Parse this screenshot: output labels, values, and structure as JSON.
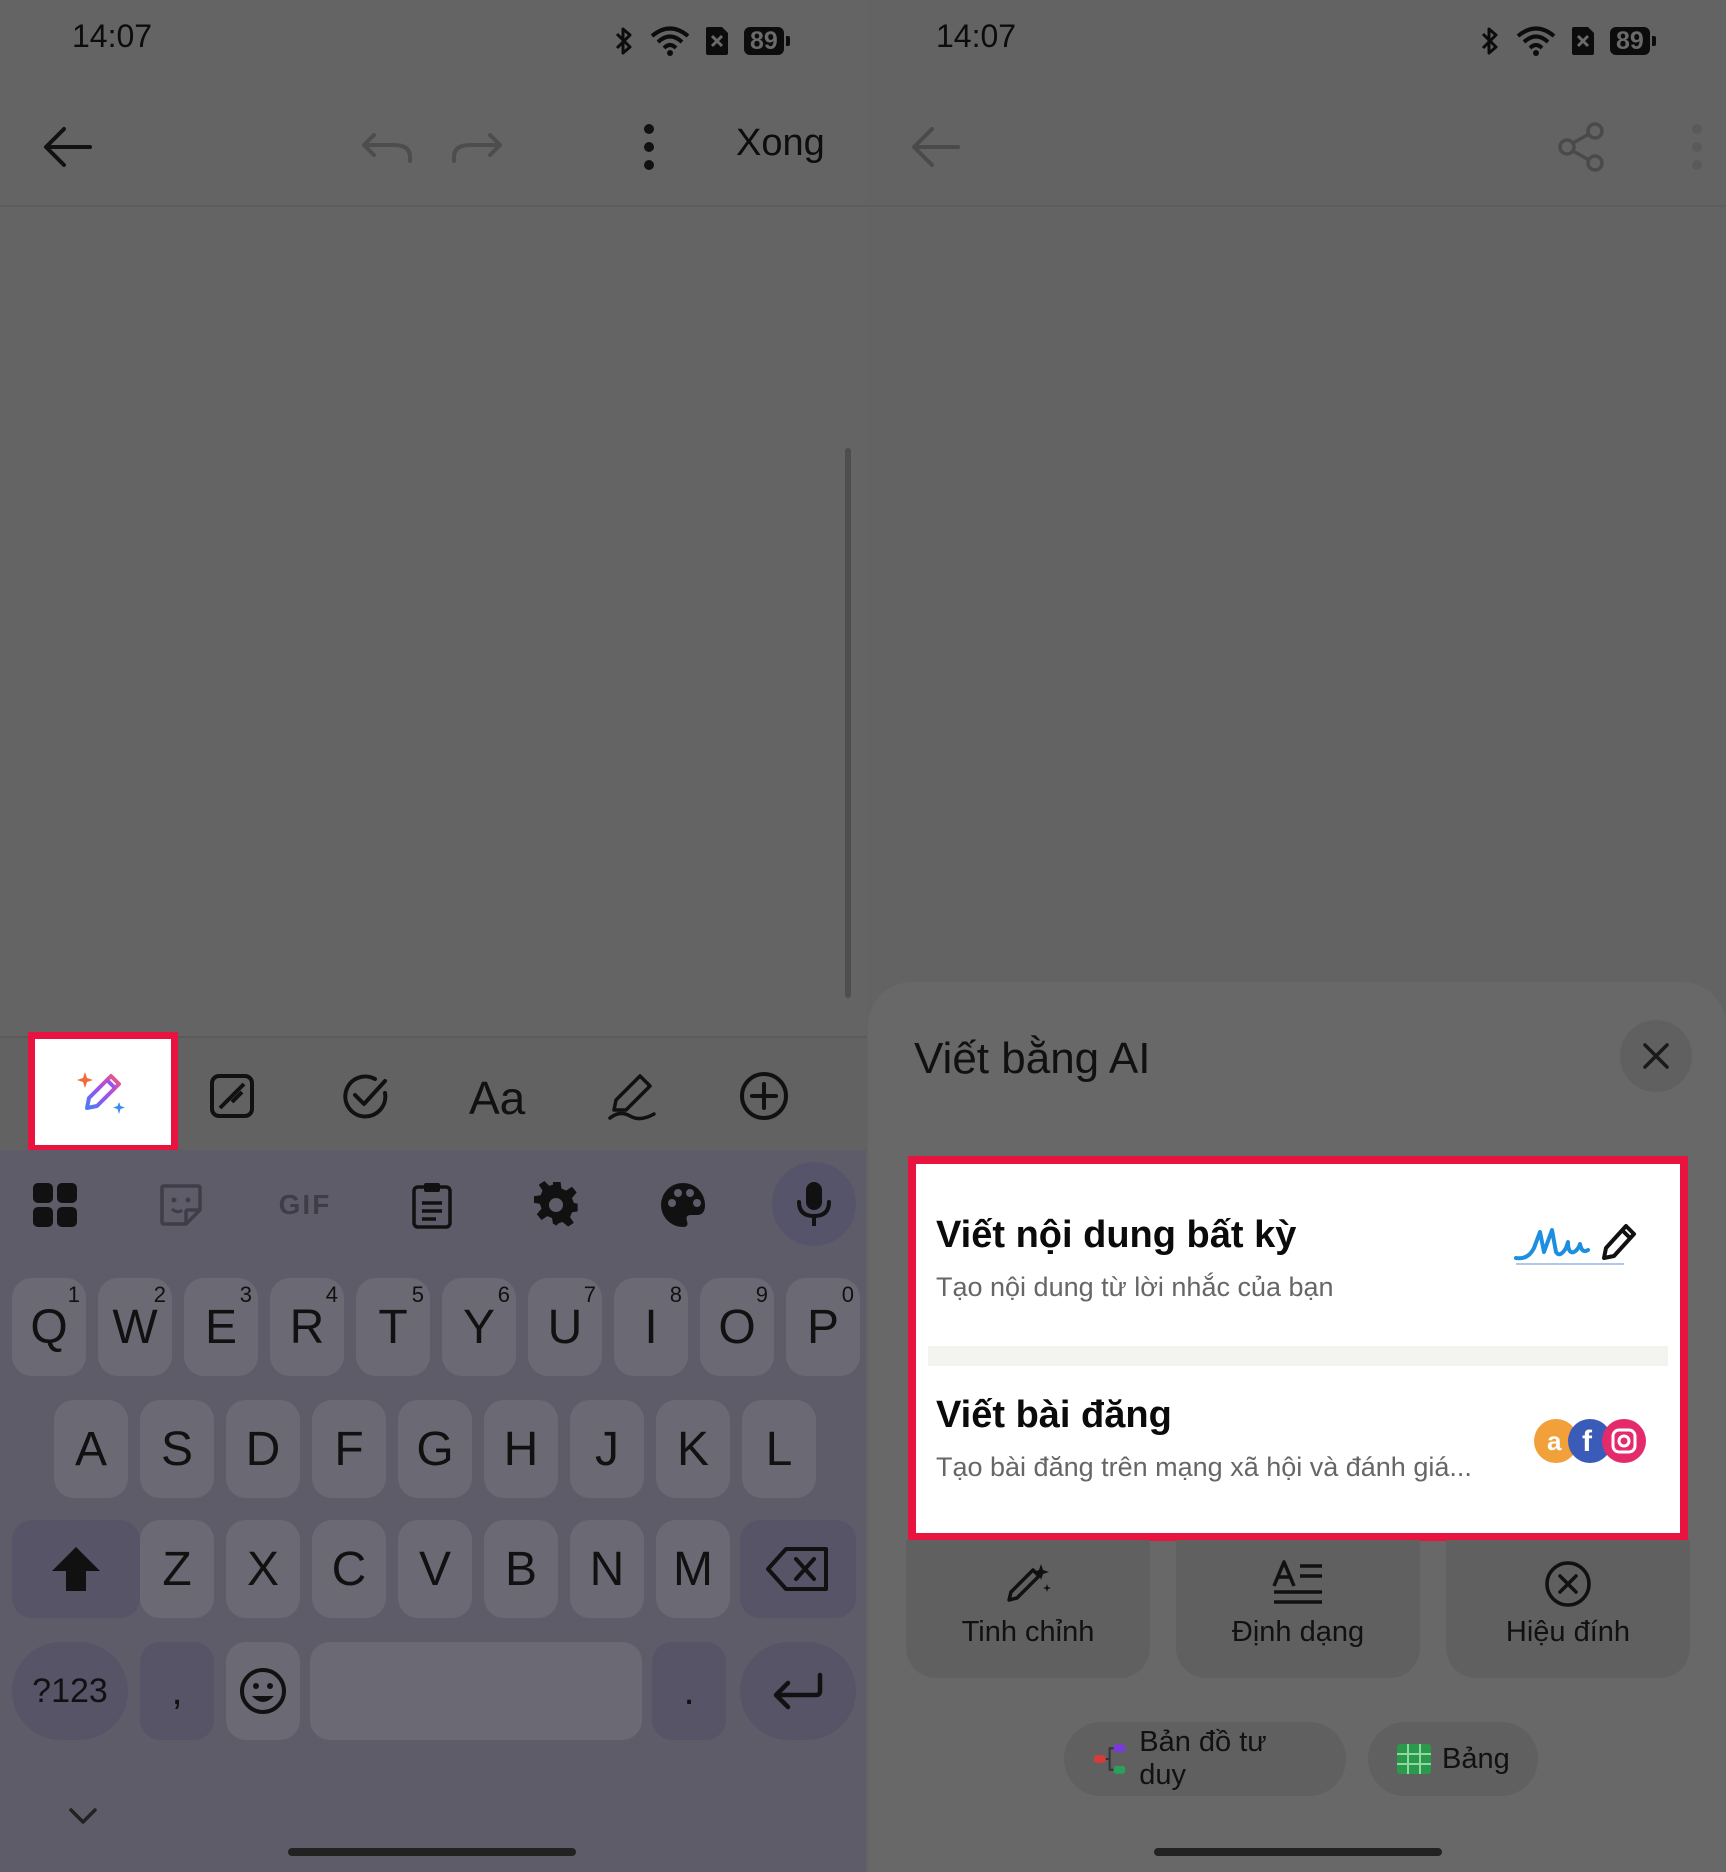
{
  "left": {
    "status": {
      "time": "14:07",
      "battery": "89"
    },
    "topbar": {
      "done_label": "Xong"
    },
    "keyboard": {
      "row1": [
        {
          "label": "Q",
          "num": "1"
        },
        {
          "label": "W",
          "num": "2"
        },
        {
          "label": "E",
          "num": "3"
        },
        {
          "label": "R",
          "num": "4"
        },
        {
          "label": "T",
          "num": "5"
        },
        {
          "label": "Y",
          "num": "6"
        },
        {
          "label": "U",
          "num": "7"
        },
        {
          "label": "I",
          "num": "8"
        },
        {
          "label": "O",
          "num": "9"
        },
        {
          "label": "P",
          "num": "0"
        }
      ],
      "row2": [
        "A",
        "S",
        "D",
        "F",
        "G",
        "H",
        "J",
        "K",
        "L"
      ],
      "row3": [
        "Z",
        "X",
        "C",
        "V",
        "B",
        "N",
        "M"
      ],
      "symbols_label": "?123",
      "comma_label": ",",
      "period_label": ".",
      "gif_label": "GIF"
    }
  },
  "right": {
    "status": {
      "time": "14:07",
      "battery": "89"
    },
    "sheet": {
      "title": "Viết bằng AI",
      "cards": [
        {
          "title": "Viết nội dung bất kỳ",
          "subtitle": "Tạo nội dung từ lời nhắc của bạn",
          "art": "signature-pen-icon"
        },
        {
          "title": "Viết bài đăng",
          "subtitle": "Tạo bài đăng trên mạng xã hội và đánh giá...",
          "art": "social-icons"
        }
      ],
      "actions": [
        {
          "label": "Tinh chỉnh",
          "icon": "magic-wand-icon"
        },
        {
          "label": "Định dạng",
          "icon": "format-text-icon"
        },
        {
          "label": "Hiệu đính",
          "icon": "proofread-icon"
        }
      ],
      "chips": [
        {
          "label": "Bản đồ tư duy",
          "icon": "mind-map-icon"
        },
        {
          "label": "Bảng",
          "icon": "table-icon"
        }
      ]
    }
  },
  "colors": {
    "highlight": "#e8133f"
  }
}
